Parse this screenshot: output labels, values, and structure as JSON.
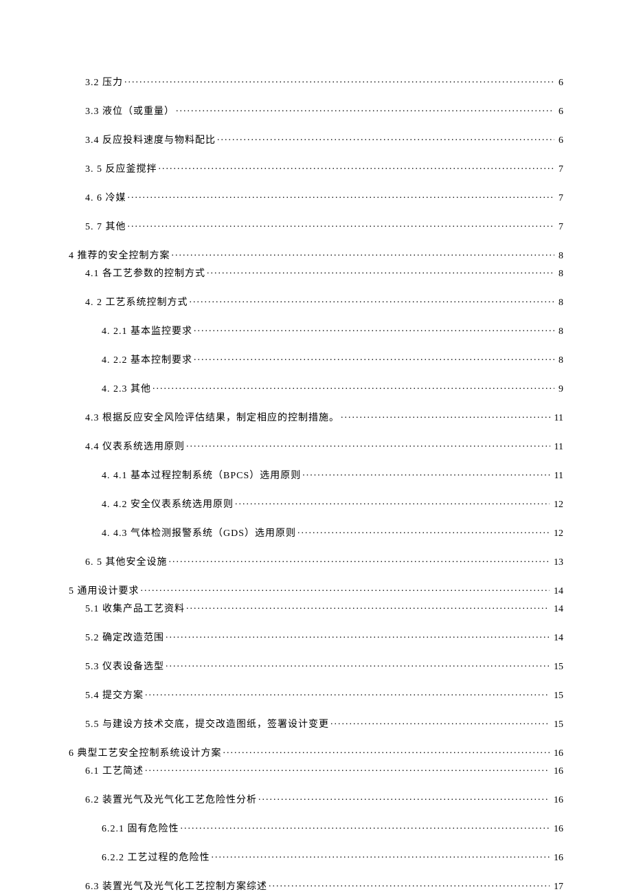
{
  "toc": [
    {
      "indent": 1,
      "label": "3.2 压力 ",
      "page": "6",
      "spacing": "mb-small"
    },
    {
      "indent": 1,
      "label": "3.3 液位（或重量）",
      "page": "6",
      "spacing": "mb-small"
    },
    {
      "indent": 1,
      "label": "3.4 反应投料速度与物料配比 ",
      "page": "6",
      "spacing": "mb-small"
    },
    {
      "indent": 1,
      "label": "3.  5 反应釜搅拌 ",
      "page": "7",
      "spacing": "mb-small"
    },
    {
      "indent": 1,
      "label": "4.  6 冷媒 ",
      "page": "7",
      "spacing": "mb-small"
    },
    {
      "indent": 1,
      "label": "5.  7 其他 ",
      "page": "7",
      "spacing": "mb-small"
    },
    {
      "indent": 0,
      "label": "4 推荐的安全控制方案",
      "page": "8",
      "spacing": "mb-tight"
    },
    {
      "indent": 1,
      "label": "4.1 各工艺参数的控制方式 ",
      "page": "8",
      "spacing": "mb-small"
    },
    {
      "indent": 1,
      "label": "4.  2 工艺系统控制方式 ",
      "page": "8",
      "spacing": "mb-small"
    },
    {
      "indent": 2,
      "label": "4.  2.1 基本监控要求",
      "page": "8",
      "spacing": "mb-small"
    },
    {
      "indent": 2,
      "label": "4.  2.2 基本控制要求",
      "page": "8",
      "spacing": "mb-small"
    },
    {
      "indent": 2,
      "label": "4.  2.3 其他",
      "page": "9",
      "spacing": "mb-small"
    },
    {
      "indent": 1,
      "label": "4.3   根据反应安全风险评估结果，制定相应的控制措施。",
      "page": "11",
      "spacing": "mb-small"
    },
    {
      "indent": 1,
      "label": "4.4   仪表系统选用原则",
      "page": "11",
      "spacing": "mb-small"
    },
    {
      "indent": 2,
      "label": "4.  4.1 基本过程控制系统（BPCS）选用原则",
      "page": "11",
      "spacing": "mb-small"
    },
    {
      "indent": 2,
      "label": "4.  4.2 安全仪表系统选用原则",
      "page": "12",
      "spacing": "mb-small"
    },
    {
      "indent": 2,
      "label": "4.  4.3 气体检测报警系统（GDS）选用原则",
      "page": "12",
      "spacing": "mb-small"
    },
    {
      "indent": 1,
      "label": "6.  5 其他安全设施 ",
      "page": "13",
      "spacing": "mb-small"
    },
    {
      "indent": 0,
      "label": "5 通用设计要求",
      "page": "14",
      "spacing": "mb-tight"
    },
    {
      "indent": 1,
      "label": "5.1   收集产品工艺资料",
      "page": "14",
      "spacing": "mb-small"
    },
    {
      "indent": 1,
      "label": "5.2   确定改造范围",
      "page": "14",
      "spacing": "mb-small"
    },
    {
      "indent": 1,
      "label": "5.3   仪表设备选型",
      "page": "15",
      "spacing": "mb-small"
    },
    {
      "indent": 1,
      "label": "5.4   提交方案",
      "page": "15",
      "spacing": "mb-small"
    },
    {
      "indent": 1,
      "label": "5.5   与建设方技术交底，提交改造图纸，签署设计变更",
      "page": "15",
      "spacing": "mb-small"
    },
    {
      "indent": 0,
      "label": "6 典型工艺安全控制系统设计方案",
      "page": "16",
      "spacing": "mb-tight"
    },
    {
      "indent": 1,
      "label": "6.1 工艺简述 ",
      "page": "16",
      "spacing": "mb-small"
    },
    {
      "indent": 1,
      "label": "6.2 装置光气及光气化工艺危险性分析 ",
      "page": "16",
      "spacing": "mb-small"
    },
    {
      "indent": 2,
      "label": "6.2.1 固有危险性 ",
      "page": "16",
      "spacing": "mb-small"
    },
    {
      "indent": 2,
      "label": "6.2.2 工艺过程的危险性 ",
      "page": "16",
      "spacing": "mb-small"
    },
    {
      "indent": 1,
      "label": "6.3 装置光气及光气化工艺控制方案综述 ",
      "page": "17",
      "spacing": "mb-small"
    }
  ]
}
